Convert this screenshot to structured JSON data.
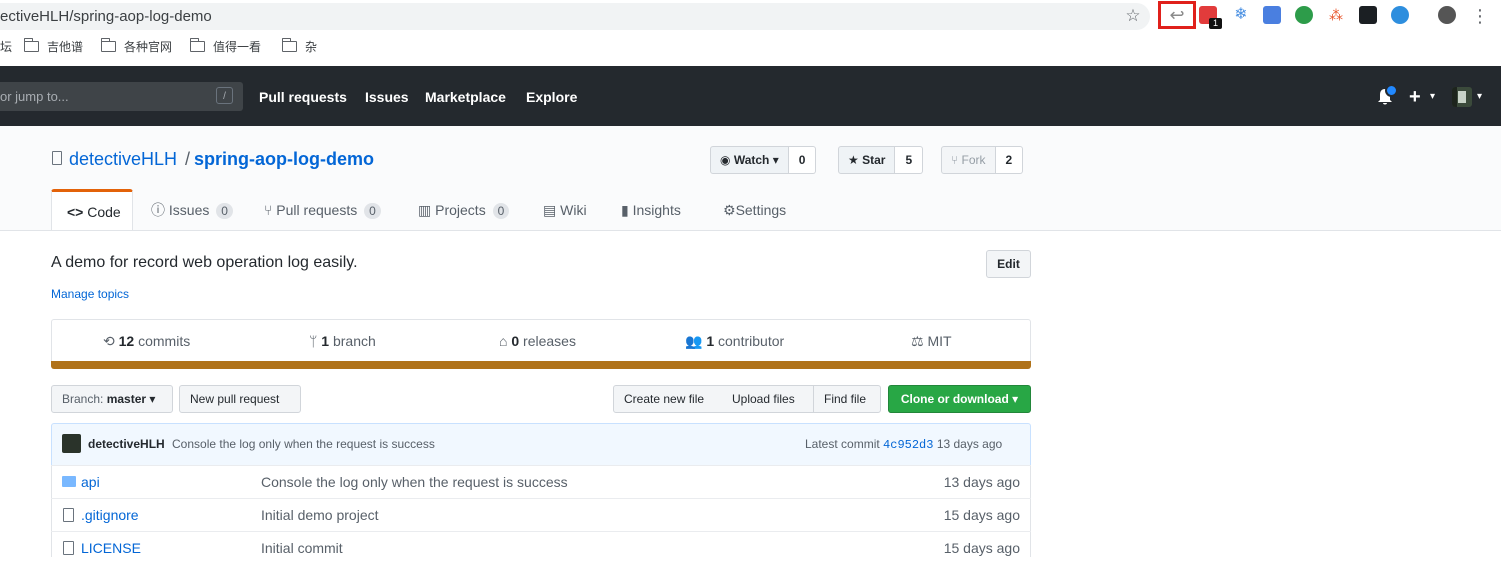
{
  "browser": {
    "url": "ectiveHLH/spring-aop-log-demo",
    "bookmarks": [
      "坛",
      "吉他谱",
      "各种官网",
      "值得一看",
      "杂"
    ],
    "extension_badge": "1"
  },
  "gh_header": {
    "search_placeholder": "or jump to...",
    "slash_key": "/",
    "nav": [
      "Pull requests",
      "Issues",
      "Marketplace",
      "Explore"
    ],
    "plus": "+"
  },
  "repo": {
    "owner": "detectiveHLH",
    "separator": "/",
    "name": "spring-aop-log-demo",
    "watch_label": "Watch",
    "watch_count": "0",
    "star_label": "Star",
    "star_count": "5",
    "fork_label": "Fork",
    "fork_count": "2"
  },
  "tabs": {
    "code": "Code",
    "issues": "Issues",
    "issues_count": "0",
    "pulls": "Pull requests",
    "pulls_count": "0",
    "projects": "Projects",
    "projects_count": "0",
    "wiki": "Wiki",
    "insights": "Insights",
    "settings": "Settings"
  },
  "about": {
    "description": "A demo for record web operation log easily.",
    "manage_topics": "Manage topics",
    "edit": "Edit"
  },
  "summary": {
    "commits_n": "12",
    "commits_label": "commits",
    "branch_n": "1",
    "branch_label": "branch",
    "releases_n": "0",
    "releases_label": "releases",
    "contrib_n": "1",
    "contrib_label": "contributor",
    "license": "MIT",
    "language_color": "#b07219"
  },
  "toolbar": {
    "branch_prefix": "Branch:",
    "branch_name": "master",
    "new_pr": "New pull request",
    "create_file": "Create new file",
    "upload_files": "Upload files",
    "find_file": "Find file",
    "clone": "Clone or download"
  },
  "commit": {
    "author": "detectiveHLH",
    "message": "Console the log only when the request is success",
    "latest_label": "Latest commit",
    "sha": "4c952d3",
    "age": "13 days ago"
  },
  "files": [
    {
      "name": "api",
      "message": "Console the log only when the request is success",
      "age": "13 days ago",
      "type": "dir"
    },
    {
      "name": ".gitignore",
      "message": "Initial demo project",
      "age": "15 days ago",
      "type": "file"
    },
    {
      "name": "LICENSE",
      "message": "Initial commit",
      "age": "15 days ago",
      "type": "file"
    }
  ],
  "colors": {
    "brand_dark": "#24292e",
    "link": "#0366d6",
    "clone_green": "#28a745",
    "active_tab": "#e36209",
    "highlight_red": "#e0201b"
  }
}
